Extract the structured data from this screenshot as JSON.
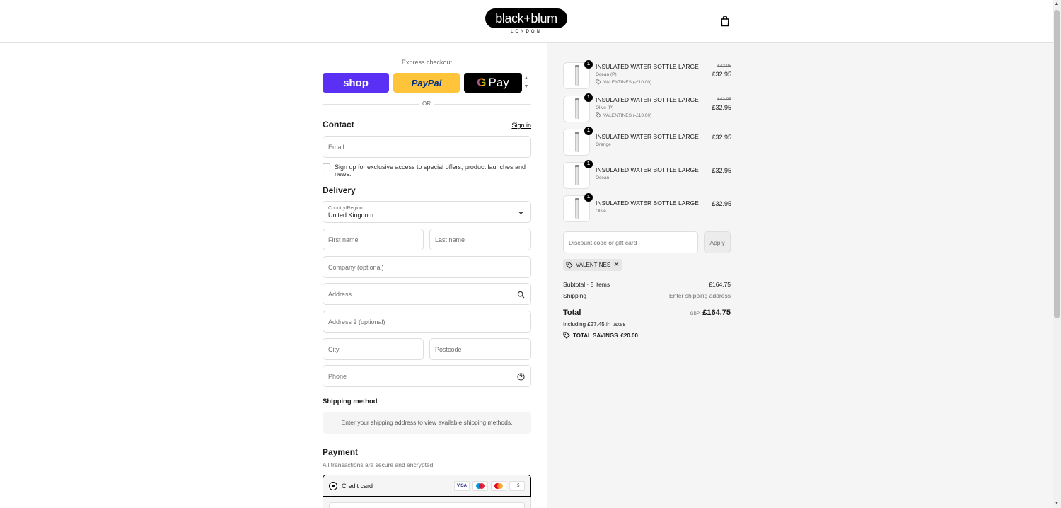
{
  "brand": {
    "name": "black+blum",
    "sub": "LONDON"
  },
  "express": {
    "title": "Express checkout",
    "shop_label": "shop",
    "paypal_label": "PayPal",
    "gpay_g": "G",
    "gpay_label": "Pay",
    "or_label": "OR"
  },
  "contact": {
    "title": "Contact",
    "sign_in": "Sign in",
    "email_placeholder": "Email",
    "newsletter_label": "Sign up for exclusive access to special offers, product launches and news."
  },
  "delivery": {
    "title": "Delivery",
    "country_label": "Country/Region",
    "country_value": "United Kingdom",
    "first_name": "First name",
    "last_name": "Last name",
    "company": "Company (optional)",
    "address": "Address",
    "address2": "Address 2 (optional)",
    "city": "City",
    "postcode": "Postcode",
    "phone": "Phone"
  },
  "shipping_method": {
    "title": "Shipping method",
    "info": "Enter your shipping address to view available shipping methods."
  },
  "payment": {
    "title": "Payment",
    "subtitle": "All transactions are secure and encrypted.",
    "credit_card_label": "Credit card",
    "card_logos": [
      "VISA",
      "Maestro",
      "Mastercard",
      "+5"
    ]
  },
  "items": [
    {
      "qty": "1",
      "name": "INSULATED WATER BOTTLE LARGE",
      "variant": "Ocean (P)",
      "discount": "VALENTINES (-£10.00)",
      "old_price": "£42.95",
      "price": "£32.95"
    },
    {
      "qty": "1",
      "name": "INSULATED WATER BOTTLE LARGE",
      "variant": "Olive (P)",
      "discount": "VALENTINES (-£10.00)",
      "old_price": "£42.95",
      "price": "£32.95"
    },
    {
      "qty": "1",
      "name": "INSULATED WATER BOTTLE LARGE",
      "variant": "Orange",
      "price": "£32.95"
    },
    {
      "qty": "1",
      "name": "INSULATED WATER BOTTLE LARGE",
      "variant": "Ocean",
      "price": "£32.95"
    },
    {
      "qty": "1",
      "name": "INSULATED WATER BOTTLE LARGE",
      "variant": "Olive",
      "price": "£32.95"
    }
  ],
  "discount": {
    "placeholder": "Discount code or gift card",
    "apply_label": "Apply",
    "applied_code": "VALENTINES",
    "remove_symbol": "✕"
  },
  "summary": {
    "subtotal_label": "Subtotal · 5 items",
    "subtotal_value": "£164.75",
    "shipping_label": "Shipping",
    "shipping_value": "Enter shipping address",
    "total_label": "Total",
    "currency": "GBP",
    "total_value": "£164.75",
    "taxes_note": "Including £27.45 in taxes",
    "savings_label": "TOTAL SAVINGS",
    "savings_value": "£20.00"
  },
  "icons": {
    "cart": "shopping-bag-icon",
    "search": "search-icon",
    "help": "help-circle-icon",
    "chevron": "chevron-down-icon",
    "tag": "tag-icon"
  }
}
